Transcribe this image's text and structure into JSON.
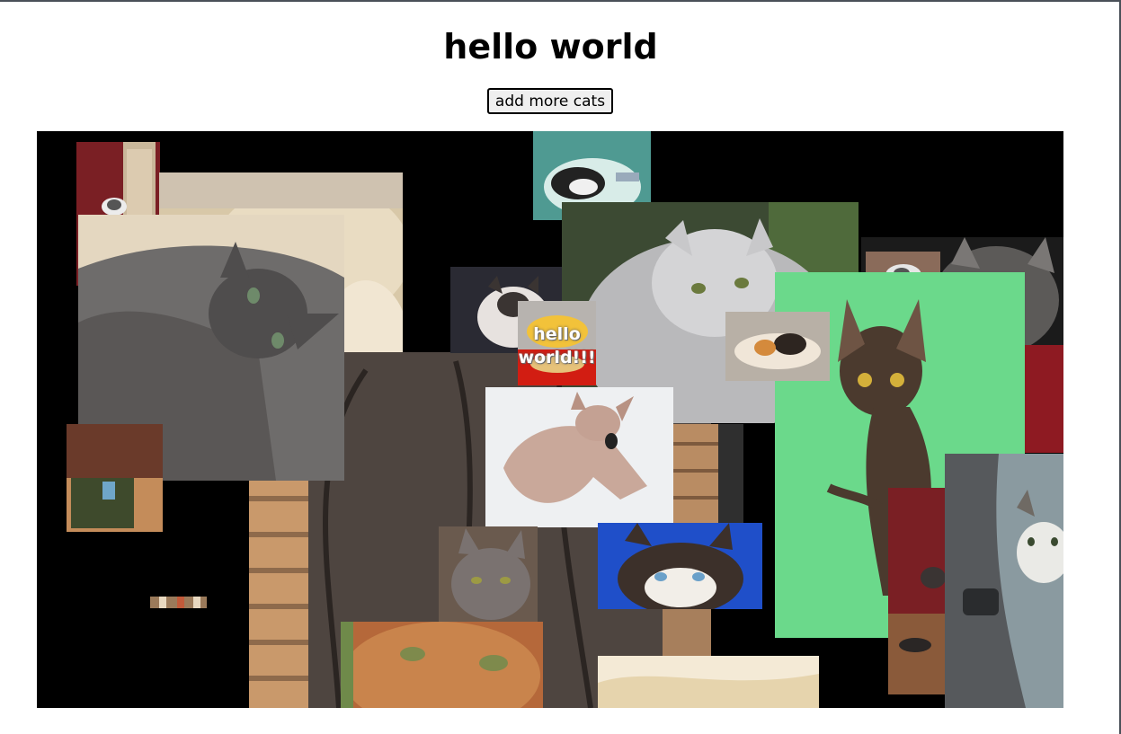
{
  "page": {
    "heading": "hello world",
    "add_button_label": "add more cats"
  },
  "sticker": {
    "text": "hello world!!!"
  },
  "colors": {
    "canvas": "#000000",
    "frame": "#4a5058",
    "green_screen": "#6bd98b",
    "door_red": "#7a1f24"
  }
}
